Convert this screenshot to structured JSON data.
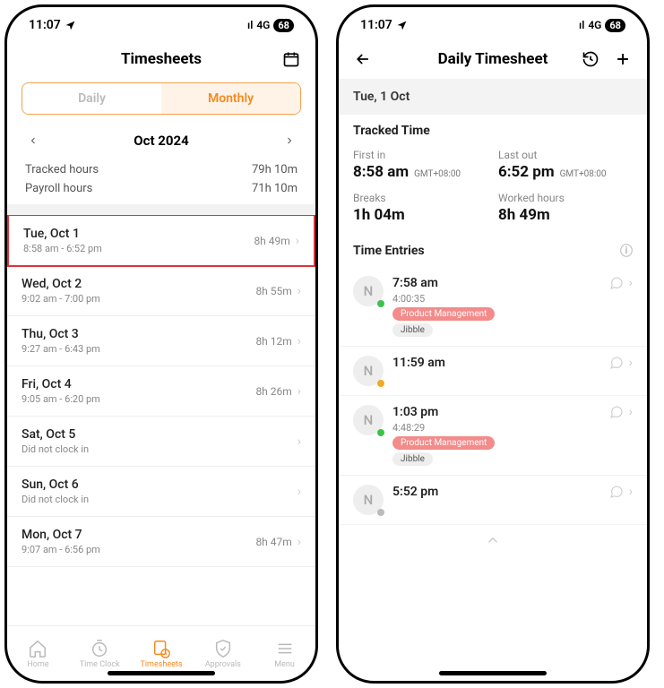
{
  "status": {
    "time": "11:07",
    "network": "4G",
    "battery": "68"
  },
  "left": {
    "title": "Timesheets",
    "seg_daily": "Daily",
    "seg_monthly": "Monthly",
    "month_label": "Oct 2024",
    "tracked_label": "Tracked hours",
    "tracked_value": "79h 10m",
    "payroll_label": "Payroll hours",
    "payroll_value": "71h 10m",
    "days": [
      {
        "date": "Tue, Oct 1",
        "range": "8:58 am - 6:52 pm",
        "hours": "8h 49m",
        "highlighted": true
      },
      {
        "date": "Wed, Oct 2",
        "range": "9:02 am - 7:00 pm",
        "hours": "8h 55m"
      },
      {
        "date": "Thu, Oct 3",
        "range": "9:27 am - 6:43 pm",
        "hours": "8h 12m"
      },
      {
        "date": "Fri, Oct 4",
        "range": "9:05 am - 6:20 pm",
        "hours": "8h 26m"
      },
      {
        "date": "Sat, Oct 5",
        "range": "Did not clock in",
        "hours": ""
      },
      {
        "date": "Sun, Oct 6",
        "range": "Did not clock in",
        "hours": ""
      },
      {
        "date": "Mon, Oct 7",
        "range": "9:07 am - 6:56 pm",
        "hours": "8h 47m"
      }
    ],
    "tabs": {
      "home": "Home",
      "clock": "Time Clock",
      "sheets": "Timesheets",
      "approvals": "Approvals",
      "menu": "Menu"
    }
  },
  "right": {
    "title": "Daily Timesheet",
    "date": "Tue, 1 Oct",
    "section_tracked": "Tracked Time",
    "first_in_lbl": "First in",
    "first_in_val": "8:58 am",
    "tz": "GMT+08:00",
    "last_out_lbl": "Last out",
    "last_out_val": "6:52 pm",
    "breaks_lbl": "Breaks",
    "breaks_val": "1h 04m",
    "worked_lbl": "Worked hours",
    "worked_val": "8h 49m",
    "entries_title": "Time Entries",
    "entries": [
      {
        "initial": "N",
        "dot": "#3bc24a",
        "time": "7:58 am",
        "dur": "4:00:35",
        "tag1": "Product Management",
        "tag2": "Jibble"
      },
      {
        "initial": "N",
        "dot": "#f5a623",
        "time": "11:59 am"
      },
      {
        "initial": "N",
        "dot": "#3bc24a",
        "time": "1:03 pm",
        "dur": "4:48:29",
        "tag1": "Product Management",
        "tag2": "Jibble"
      },
      {
        "initial": "N",
        "dot": "#bbb",
        "time": "5:52 pm"
      }
    ]
  }
}
